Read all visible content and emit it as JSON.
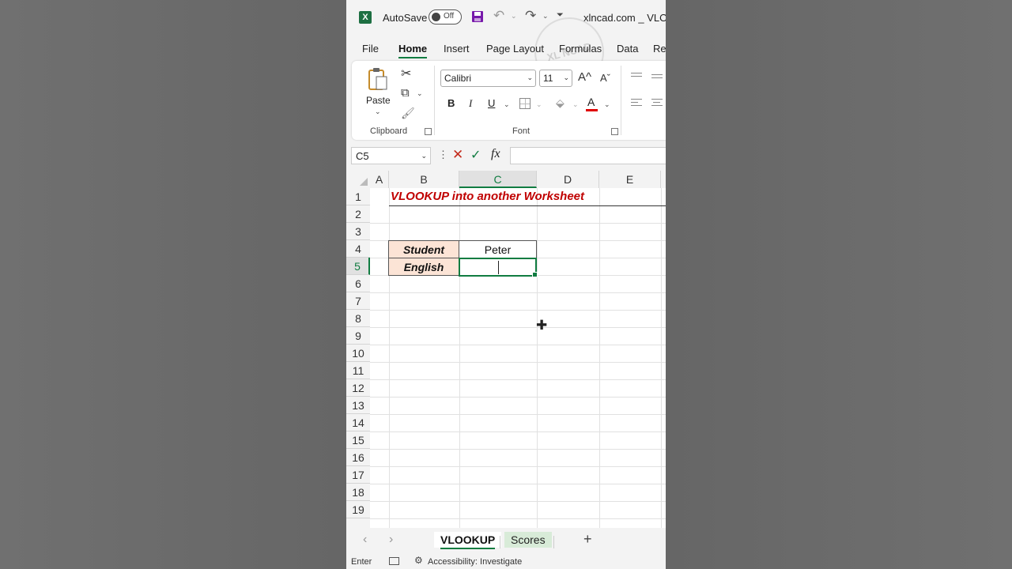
{
  "titlebar": {
    "app_icon": "excel-icon",
    "autosave_label": "AutoSave",
    "autosave_state": "Off",
    "document_title": "xlncad.com _ VLOO"
  },
  "ribbon_tabs": [
    "File",
    "Home",
    "Insert",
    "Page Layout",
    "Formulas",
    "Data",
    "Re"
  ],
  "active_tab": "Home",
  "clipboard": {
    "paste_label": "Paste",
    "group_label": "Clipboard"
  },
  "font": {
    "family": "Calibri",
    "size": "11",
    "group_label": "Font",
    "bold": "B",
    "italic": "I",
    "underline": "U",
    "grow": "A",
    "shrink": "A",
    "color_letter": "A",
    "font_color": "#e00000"
  },
  "formula_bar": {
    "name_box": "C5",
    "fx": "fx",
    "formula": ""
  },
  "columns": [
    "A",
    "B",
    "C",
    "D",
    "E"
  ],
  "rows": [
    "1",
    "2",
    "3",
    "4",
    "5",
    "6",
    "7",
    "8",
    "9",
    "10",
    "11",
    "12",
    "13",
    "14",
    "15",
    "16",
    "17",
    "18",
    "19"
  ],
  "sheet": {
    "title": "VLOOKUP into another Worksheet",
    "student_label": "Student",
    "student_value": "Peter",
    "subject_label": "English",
    "subject_value": ""
  },
  "sheet_tabs": {
    "active": "VLOOKUP",
    "other": "Scores"
  },
  "statusbar": {
    "mode": "Enter",
    "accessibility": "Accessibility: Investigate"
  },
  "colors": {
    "accent": "#107c41",
    "title_red": "#c00000",
    "label_fill": "#fce4d6"
  }
}
